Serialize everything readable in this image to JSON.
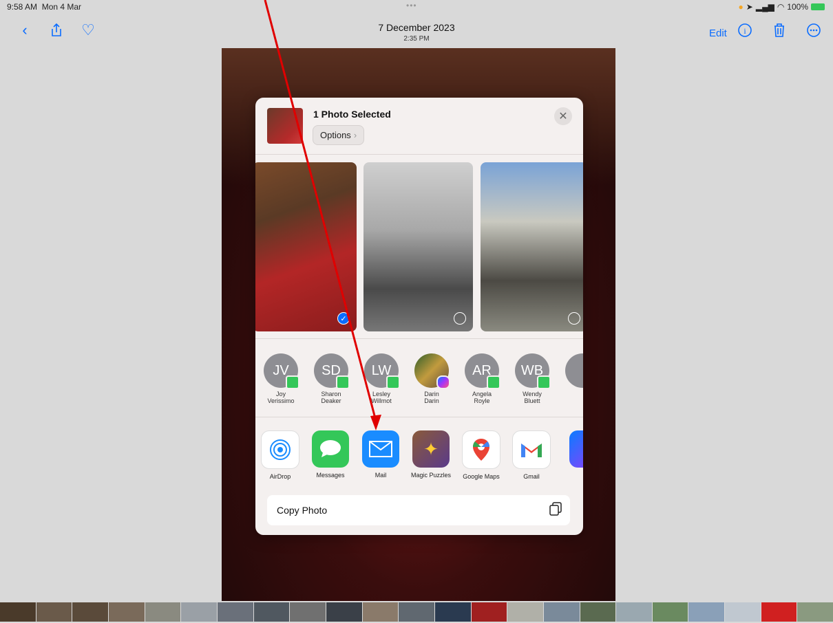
{
  "status": {
    "time": "9:58 AM",
    "date": "Mon 4 Mar",
    "battery": "100%"
  },
  "header": {
    "title": "7 December 2023",
    "subtitle": "2:35 PM",
    "edit_label": "Edit"
  },
  "share": {
    "title": "1 Photo Selected",
    "options_label": "Options",
    "contacts": [
      {
        "initials": "JV",
        "name": "Joy\nVerissimo",
        "service": "messages"
      },
      {
        "initials": "SD",
        "name": "Sharon\nDeaker",
        "service": "messages"
      },
      {
        "initials": "LW",
        "name": "Lesley\nWillmot",
        "service": "messages"
      },
      {
        "initials": "",
        "name": "Darin\nDarin",
        "service": "messenger"
      },
      {
        "initials": "AR",
        "name": "Angela\nRoyle",
        "service": "messages"
      },
      {
        "initials": "WB",
        "name": "Wendy\nBluett",
        "service": "messages"
      }
    ],
    "apps": [
      {
        "label": "AirDrop",
        "icon": "airdrop-icon",
        "bg": "#ffffff",
        "fg": "#1a8cff"
      },
      {
        "label": "Messages",
        "icon": "messages-icon",
        "bg": "#34c759",
        "fg": "#ffffff"
      },
      {
        "label": "Mail",
        "icon": "mail-icon",
        "bg": "#1a8cff",
        "fg": "#ffffff"
      },
      {
        "label": "Magic Puzzles",
        "icon": "puzzle-icon",
        "bg": "#6b4f3a",
        "fg": "#ffcc33"
      },
      {
        "label": "Google Maps",
        "icon": "google-maps-icon",
        "bg": "#ffffff",
        "fg": "#ea4335"
      },
      {
        "label": "Gmail",
        "icon": "gmail-icon",
        "bg": "#ffffff",
        "fg": "#ea4335"
      }
    ],
    "copy_label": "Copy Photo"
  },
  "colors": {
    "accent": "#0a6cff",
    "annotation": "#e00000"
  }
}
